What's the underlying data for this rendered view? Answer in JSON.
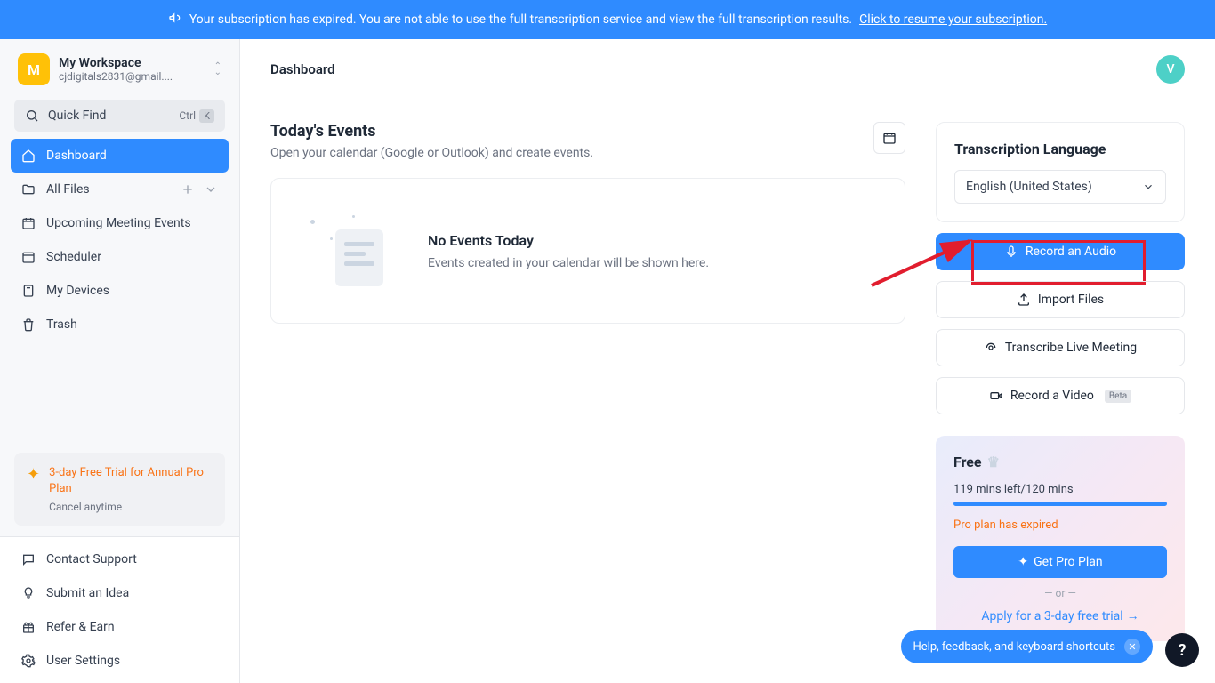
{
  "banner": {
    "text": "Your subscription has expired. You are not able to use the full transcription service and view the full transcription results.",
    "link": "Click to resume your subscription."
  },
  "workspace": {
    "initial": "M",
    "name": "My Workspace",
    "email": "cjdigitals2831@gmail...."
  },
  "quickfind": {
    "label": "Quick Find",
    "key1": "Ctrl",
    "key2": "K"
  },
  "nav": {
    "dashboard": "Dashboard",
    "allfiles": "All Files",
    "upcoming": "Upcoming Meeting Events",
    "scheduler": "Scheduler",
    "devices": "My Devices",
    "trash": "Trash"
  },
  "trial": {
    "title": "3-day Free Trial for Annual Pro Plan",
    "sub": "Cancel anytime"
  },
  "bottomnav": {
    "contact": "Contact Support",
    "idea": "Submit an Idea",
    "refer": "Refer & Earn",
    "settings": "User Settings"
  },
  "topbar": {
    "title": "Dashboard",
    "avatar": "V"
  },
  "events": {
    "title": "Today's Events",
    "sub": "Open your calendar (Google or Outlook) and create events.",
    "none_title": "No Events Today",
    "none_sub": "Events created in your calendar will be shown here."
  },
  "rpanel": {
    "lang_title": "Transcription Language",
    "lang_value": "English (United States)",
    "record": "Record an Audio",
    "import": "Import Files",
    "live": "Transcribe Live Meeting",
    "video": "Record a Video",
    "beta": "Beta"
  },
  "plan": {
    "tier": "Free",
    "mins": "119 mins left/120 mins",
    "expired": "Pro plan has expired",
    "get_pro": "Get Pro Plan",
    "or": "or",
    "apply": "Apply for a 3-day free trial"
  },
  "help": {
    "pill": "Help, feedback, and keyboard shortcuts",
    "fab": "?"
  }
}
